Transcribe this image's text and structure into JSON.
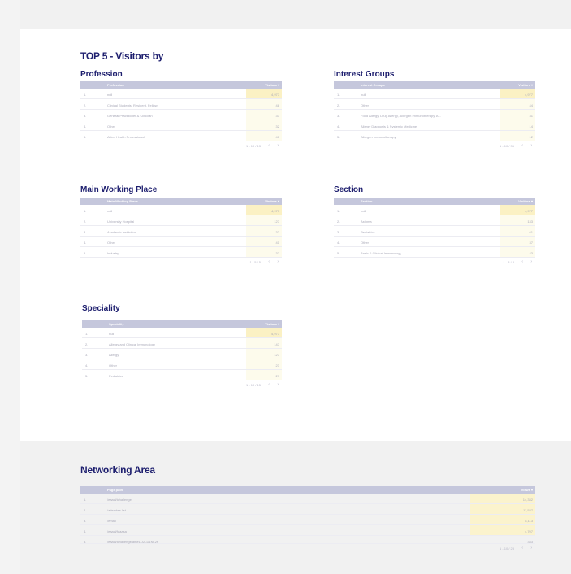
{
  "titles": {
    "main": "TOP 5 - Visitors by",
    "profession": "Profession",
    "interest": "Interest Groups",
    "workplace": "Main Working Place",
    "section": "Section",
    "speciality": "Speciality",
    "network": "Networking Area"
  },
  "tables": {
    "profession": {
      "dimension": "Profession",
      "metric": "Visitors ▾",
      "rows": [
        {
          "rank": "1.",
          "label": "null",
          "value": "4,977"
        },
        {
          "rank": "2.",
          "label": "Clinical Students, Resident, Fellow",
          "value": "48"
        },
        {
          "rank": "3.",
          "label": "General Practitioner & Clinician",
          "value": "33"
        },
        {
          "rank": "4.",
          "label": "Other",
          "value": "32"
        },
        {
          "rank": "5.",
          "label": "Allied Health Professional",
          "value": "41"
        }
      ],
      "pager": "1 - 10 / 13",
      "prev": "‹",
      "next": "›"
    },
    "interest": {
      "dimension": "Interest Groups",
      "metric": "Visitors ▾",
      "rows": [
        {
          "rank": "1.",
          "label": "null",
          "value": "4,977"
        },
        {
          "rank": "2.",
          "label": "Other",
          "value": "44"
        },
        {
          "rank": "3.",
          "label": "Food Allergy, Drug Allergy, Allergen Immunotherapy, A...",
          "value": "31"
        },
        {
          "rank": "4.",
          "label": "Allergy Diagnosis & Systemic Medicine",
          "value": "14"
        },
        {
          "rank": "5.",
          "label": "Allergen Immunotherapy",
          "value": "12"
        }
      ],
      "pager": "1 - 10 / 36",
      "prev": "‹",
      "next": "›"
    },
    "workplace": {
      "dimension": "Main Working Place",
      "metric": "Visitors ▾",
      "rows": [
        {
          "rank": "1.",
          "label": "null",
          "value": "4,977"
        },
        {
          "rank": "2.",
          "label": "University Hospital",
          "value": "127"
        },
        {
          "rank": "3.",
          "label": "Academic Institution",
          "value": "32"
        },
        {
          "rank": "4.",
          "label": "Other",
          "value": "41"
        },
        {
          "rank": "5.",
          "label": "Industry",
          "value": "37"
        }
      ],
      "pager": "1 - 5 / 5",
      "prev": "‹",
      "next": "›"
    },
    "section": {
      "dimension": "Section",
      "metric": "Visitors ▾",
      "rows": [
        {
          "rank": "1.",
          "label": "null",
          "value": "4,977"
        },
        {
          "rank": "2.",
          "label": "Asthma",
          "value": "133"
        },
        {
          "rank": "3.",
          "label": "Pediatrics",
          "value": "61"
        },
        {
          "rank": "4.",
          "label": "Other",
          "value": "37"
        },
        {
          "rank": "5.",
          "label": "Basic & Clinical Immunology",
          "value": "43"
        }
      ],
      "pager": "1 - 8 / 8",
      "prev": "‹",
      "next": "›"
    },
    "speciality": {
      "dimension": "Speciality",
      "metric": "Visitors ▾",
      "rows": [
        {
          "rank": "1.",
          "label": "null",
          "value": "4,977"
        },
        {
          "rank": "2.",
          "label": "Allergy and Clinical Immunology",
          "value": "147"
        },
        {
          "rank": "3.",
          "label": "Allergy",
          "value": "127"
        },
        {
          "rank": "4.",
          "label": "Other",
          "value": "23"
        },
        {
          "rank": "5.",
          "label": "Pediatrics",
          "value": "29"
        }
      ],
      "pager": "1 - 10 / 15",
      "prev": "‹",
      "next": "›"
    },
    "network": {
      "dimension": "Page path",
      "metric": "Views ▾",
      "rows": [
        {
          "rank": "1.",
          "label": "/eaaci/ichallenge",
          "value": "14,332"
        },
        {
          "rank": "2.",
          "label": "/attendee-list",
          "value": "11,537"
        },
        {
          "rank": "3.",
          "label": "/email",
          "value": "8,113"
        },
        {
          "rank": "4.",
          "label": "/eaaci/faaasa",
          "value": "4,707"
        },
        {
          "rank": "5.",
          "label": "/eaaci/ichallenge/ameLO2LD1NL2f",
          "value": "333"
        }
      ],
      "pager": "1 - 10 / 23",
      "prev": "‹",
      "next": "›"
    }
  }
}
